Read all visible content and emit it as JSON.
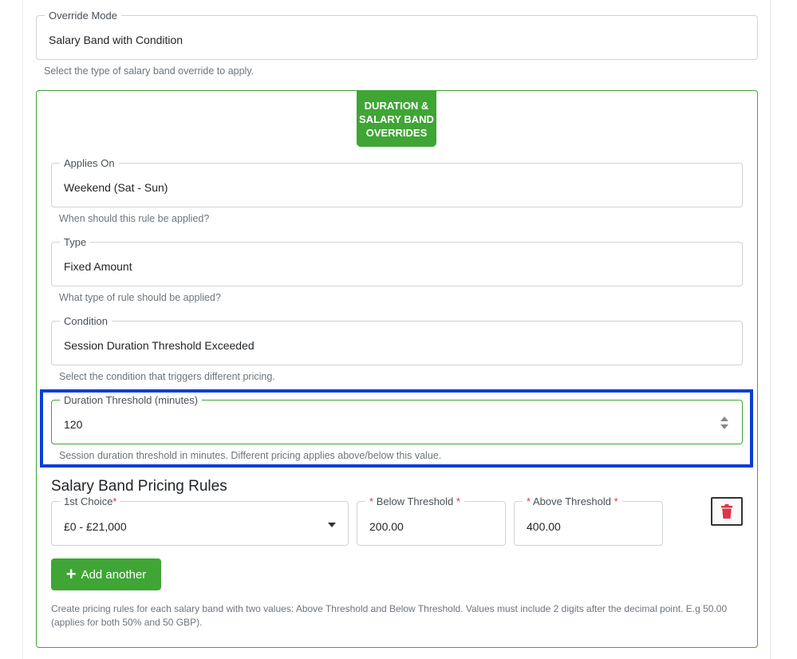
{
  "override_mode": {
    "label": "Override Mode",
    "value": "Salary Band with Condition",
    "helper": "Select the type of salary band override to apply."
  },
  "panel": {
    "badge": "DURATION & SALARY BAND OVERRIDES",
    "applies_on": {
      "label": "Applies On",
      "value": "Weekend (Sat - Sun)",
      "helper": "When should this rule be applied?"
    },
    "type": {
      "label": "Type",
      "value": "Fixed Amount",
      "helper": "What type of rule should be applied?"
    },
    "condition": {
      "label": "Condition",
      "value": "Session Duration Threshold Exceeded",
      "helper": "Select the condition that triggers different pricing."
    },
    "duration_threshold": {
      "label": "Duration Threshold (minutes)",
      "value": "120",
      "helper": "Session duration threshold in minutes. Different pricing applies above/below this value."
    },
    "pricing_rules": {
      "title": "Salary Band Pricing Rules",
      "choice_label": "1st Choice",
      "choice_value": "£0 - £21,000",
      "below_label": "Below Threshold",
      "below_value": "200.00",
      "above_label": "Above Threshold",
      "above_value": "400.00",
      "required_mark": "*"
    },
    "add_button": {
      "label": "Add another",
      "plus": "+"
    },
    "footnote": "Create pricing rules for each salary band with two values: Above Threshold and Below Threshold. Values must include 2 digits after the decimal point. E.g 50.00 (applies for both 50% and 50 GBP)."
  },
  "colors": {
    "accent_green": "#3fa535",
    "highlight_blue": "#0a3fd6",
    "delete_red": "#dc3545"
  },
  "icons": {
    "delete": "trash-icon",
    "dropdown": "chevron-down-icon",
    "spinner": "spinner-arrows-icon",
    "add": "plus-icon"
  }
}
